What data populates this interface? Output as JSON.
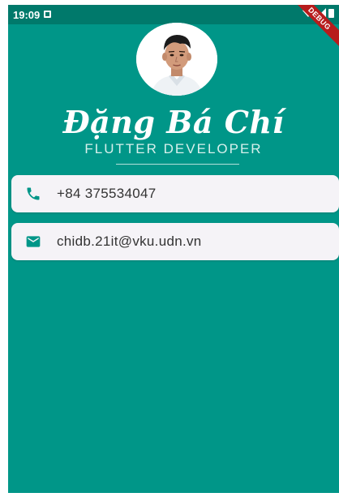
{
  "status_bar": {
    "time": "19:09"
  },
  "debug_banner": {
    "label": "DEBUG"
  },
  "profile": {
    "name": "Đặng Bá Chí",
    "title": "FLUTTER DEVELOPER"
  },
  "contacts": {
    "phone": "+84 375534047",
    "email": "chidb.21it@vku.udn.vn"
  },
  "colors": {
    "background": "#009688",
    "status_bar": "#00796B",
    "card": "#F5F3F7",
    "icon": "#009688",
    "debug_banner": "#B71C1C"
  }
}
